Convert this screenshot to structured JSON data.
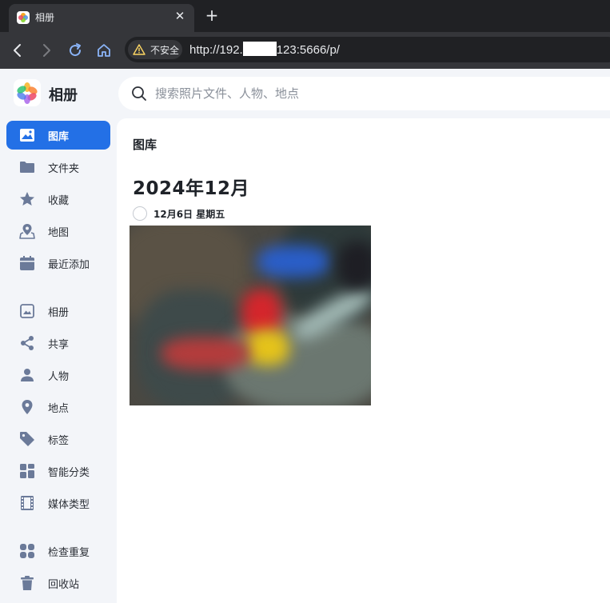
{
  "browser": {
    "tab": {
      "title": "相册",
      "close_label": "✕"
    },
    "new_tab_label": "+",
    "security_label": "不安全",
    "url_prefix": "http://192.",
    "url_suffix": "123:5666/p/"
  },
  "app": {
    "name": "相册",
    "search": {
      "placeholder": "搜索照片文件、人物、地点",
      "value": ""
    }
  },
  "sidebar": {
    "items": [
      {
        "label": "图库",
        "icon": "gallery-icon",
        "active": true
      },
      {
        "label": "文件夹",
        "icon": "folder-icon"
      },
      {
        "label": "收藏",
        "icon": "star-icon"
      },
      {
        "label": "地图",
        "icon": "map-icon"
      },
      {
        "label": "最近添加",
        "icon": "calendar-icon"
      },
      {
        "label": "相册",
        "icon": "album-icon"
      },
      {
        "label": "共享",
        "icon": "share-icon"
      },
      {
        "label": "人物",
        "icon": "person-icon"
      },
      {
        "label": "地点",
        "icon": "location-pin-icon"
      },
      {
        "label": "标签",
        "icon": "tag-icon"
      },
      {
        "label": "智能分类",
        "icon": "smart-category-icon"
      },
      {
        "label": "媒体类型",
        "icon": "film-icon"
      },
      {
        "label": "检查重复",
        "icon": "duplicate-icon"
      },
      {
        "label": "回收站",
        "icon": "trash-icon"
      }
    ]
  },
  "content": {
    "page_title": "图库",
    "month_heading": "2024年12月",
    "date_label": "12月6日 星期五"
  },
  "colors": {
    "accent": "#2370e6",
    "sidebar_bg": "#f3f5f9",
    "icon": "#6b7a99"
  }
}
